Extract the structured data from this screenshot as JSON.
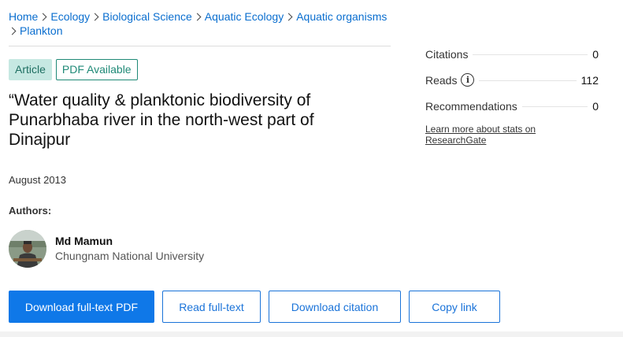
{
  "breadcrumb": {
    "items": [
      "Home",
      "Ecology",
      "Biological Science",
      "Aquatic Ecology",
      "Aquatic organisms",
      "Plankton"
    ]
  },
  "badges": {
    "article": "Article",
    "pdf": "PDF Available"
  },
  "publication": {
    "title": "“Water quality & planktonic biodiversity of Punarbhaba river in the north-west part of Dinajpur",
    "date": "August 2013",
    "authors_label": "Authors:"
  },
  "author": {
    "name": "Md Mamun",
    "affiliation": "Chungnam National University"
  },
  "actions": {
    "download_pdf": "Download full-text PDF",
    "read_full_text": "Read full-text",
    "download_citation": "Download citation",
    "copy_link": "Copy link"
  },
  "stats": {
    "citations_label": "Citations",
    "citations_value": "0",
    "reads_label": "Reads",
    "reads_value": "112",
    "recommendations_label": "Recommendations",
    "recommendations_value": "0",
    "learn_more": "Learn more about stats on ResearchGate"
  },
  "icons": {
    "info": "info-icon",
    "separator": "chevron-right-icon"
  },
  "colors": {
    "link": "#0a6ecf",
    "primary_button": "#0f78e8",
    "badge_teal": "#1f8a77",
    "badge_bg": "#c6e8e2"
  }
}
